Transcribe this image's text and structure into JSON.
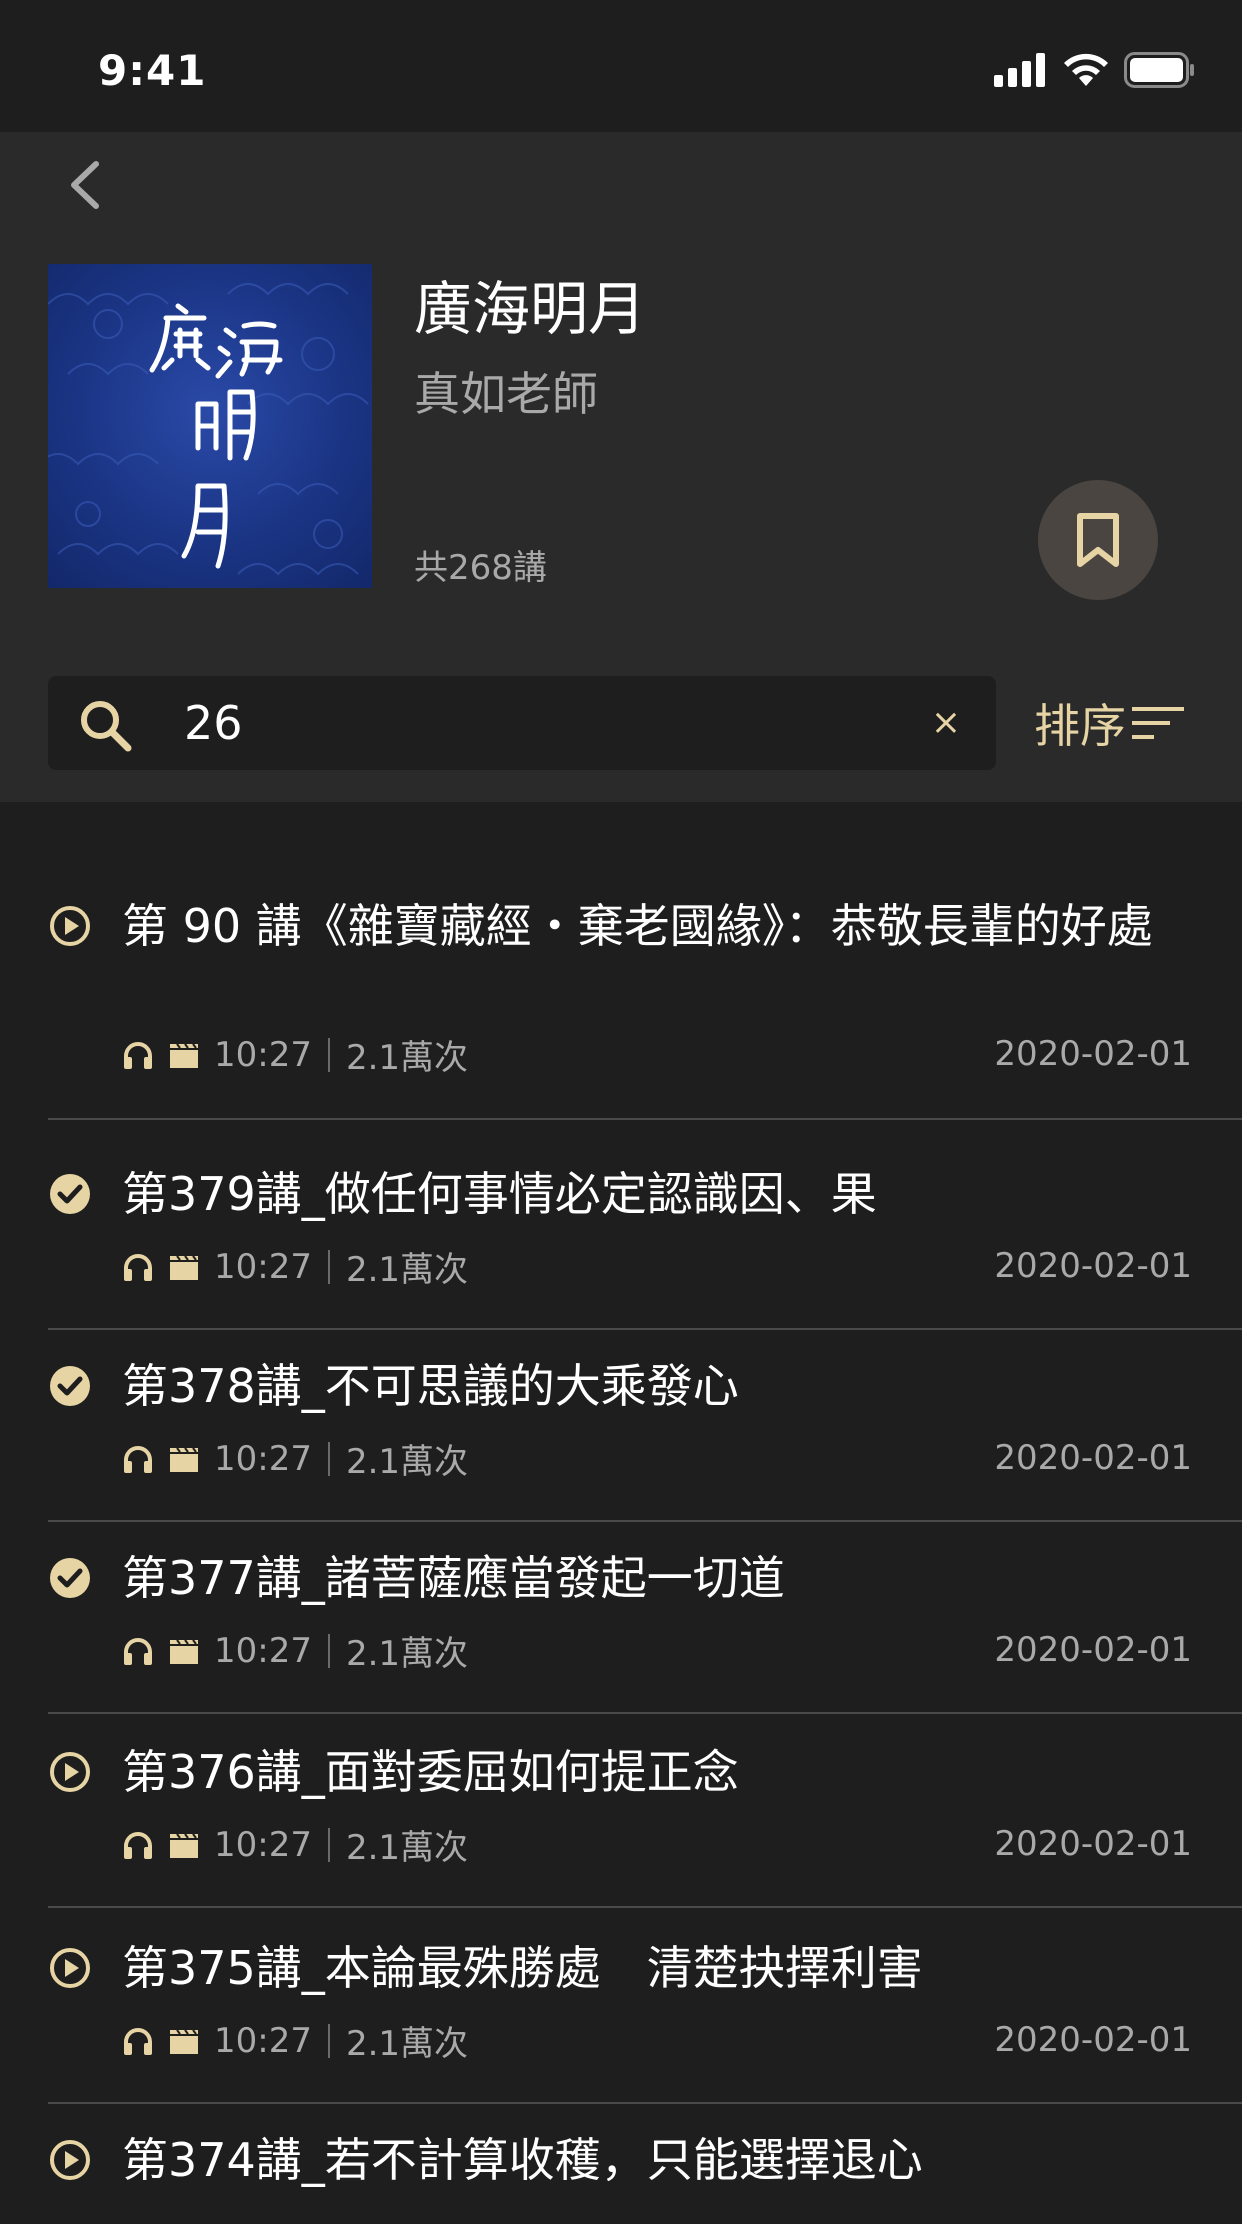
{
  "status_bar": {
    "time": "9:41"
  },
  "album": {
    "title": "廣海明月",
    "author": "真如老師",
    "count": "共268講",
    "cover_text": "廣海明月"
  },
  "search": {
    "value": "26",
    "clear_label": "×"
  },
  "sort": {
    "label": "排序"
  },
  "colors": {
    "accent": "#e7d4a5",
    "background": "#1e1e1e",
    "header": "#2a2a2a",
    "cover": "#1b3585"
  },
  "episodes": [
    {
      "title": "第 90 講《雜寶藏經・棄老國緣》：恭敬長輩的好處",
      "status_icon": "play-circle-icon",
      "duration": "10:27",
      "plays": "2.1萬次",
      "date": "2020-02-01"
    },
    {
      "title": "第379講_做任何事情必定認識因、果",
      "status_icon": "check-circle-icon",
      "duration": "10:27",
      "plays": "2.1萬次",
      "date": "2020-02-01"
    },
    {
      "title": "第378講_不可思議的大乘發心",
      "status_icon": "check-circle-icon",
      "duration": "10:27",
      "plays": "2.1萬次",
      "date": "2020-02-01"
    },
    {
      "title": "第377講_諸菩薩應當發起一切道",
      "status_icon": "check-circle-icon",
      "duration": "10:27",
      "plays": "2.1萬次",
      "date": "2020-02-01"
    },
    {
      "title": "第376講_面對委屈如何提正念",
      "status_icon": "play-circle-icon",
      "duration": "10:27",
      "plays": "2.1萬次",
      "date": "2020-02-01"
    },
    {
      "title": "第375講_本論最殊勝處　清楚抉擇利害",
      "status_icon": "play-circle-icon",
      "duration": "10:27",
      "plays": "2.1萬次",
      "date": "2020-02-01"
    },
    {
      "title": "第374講_若不計算收穫，只能選擇退心",
      "status_icon": "play-circle-icon"
    }
  ]
}
